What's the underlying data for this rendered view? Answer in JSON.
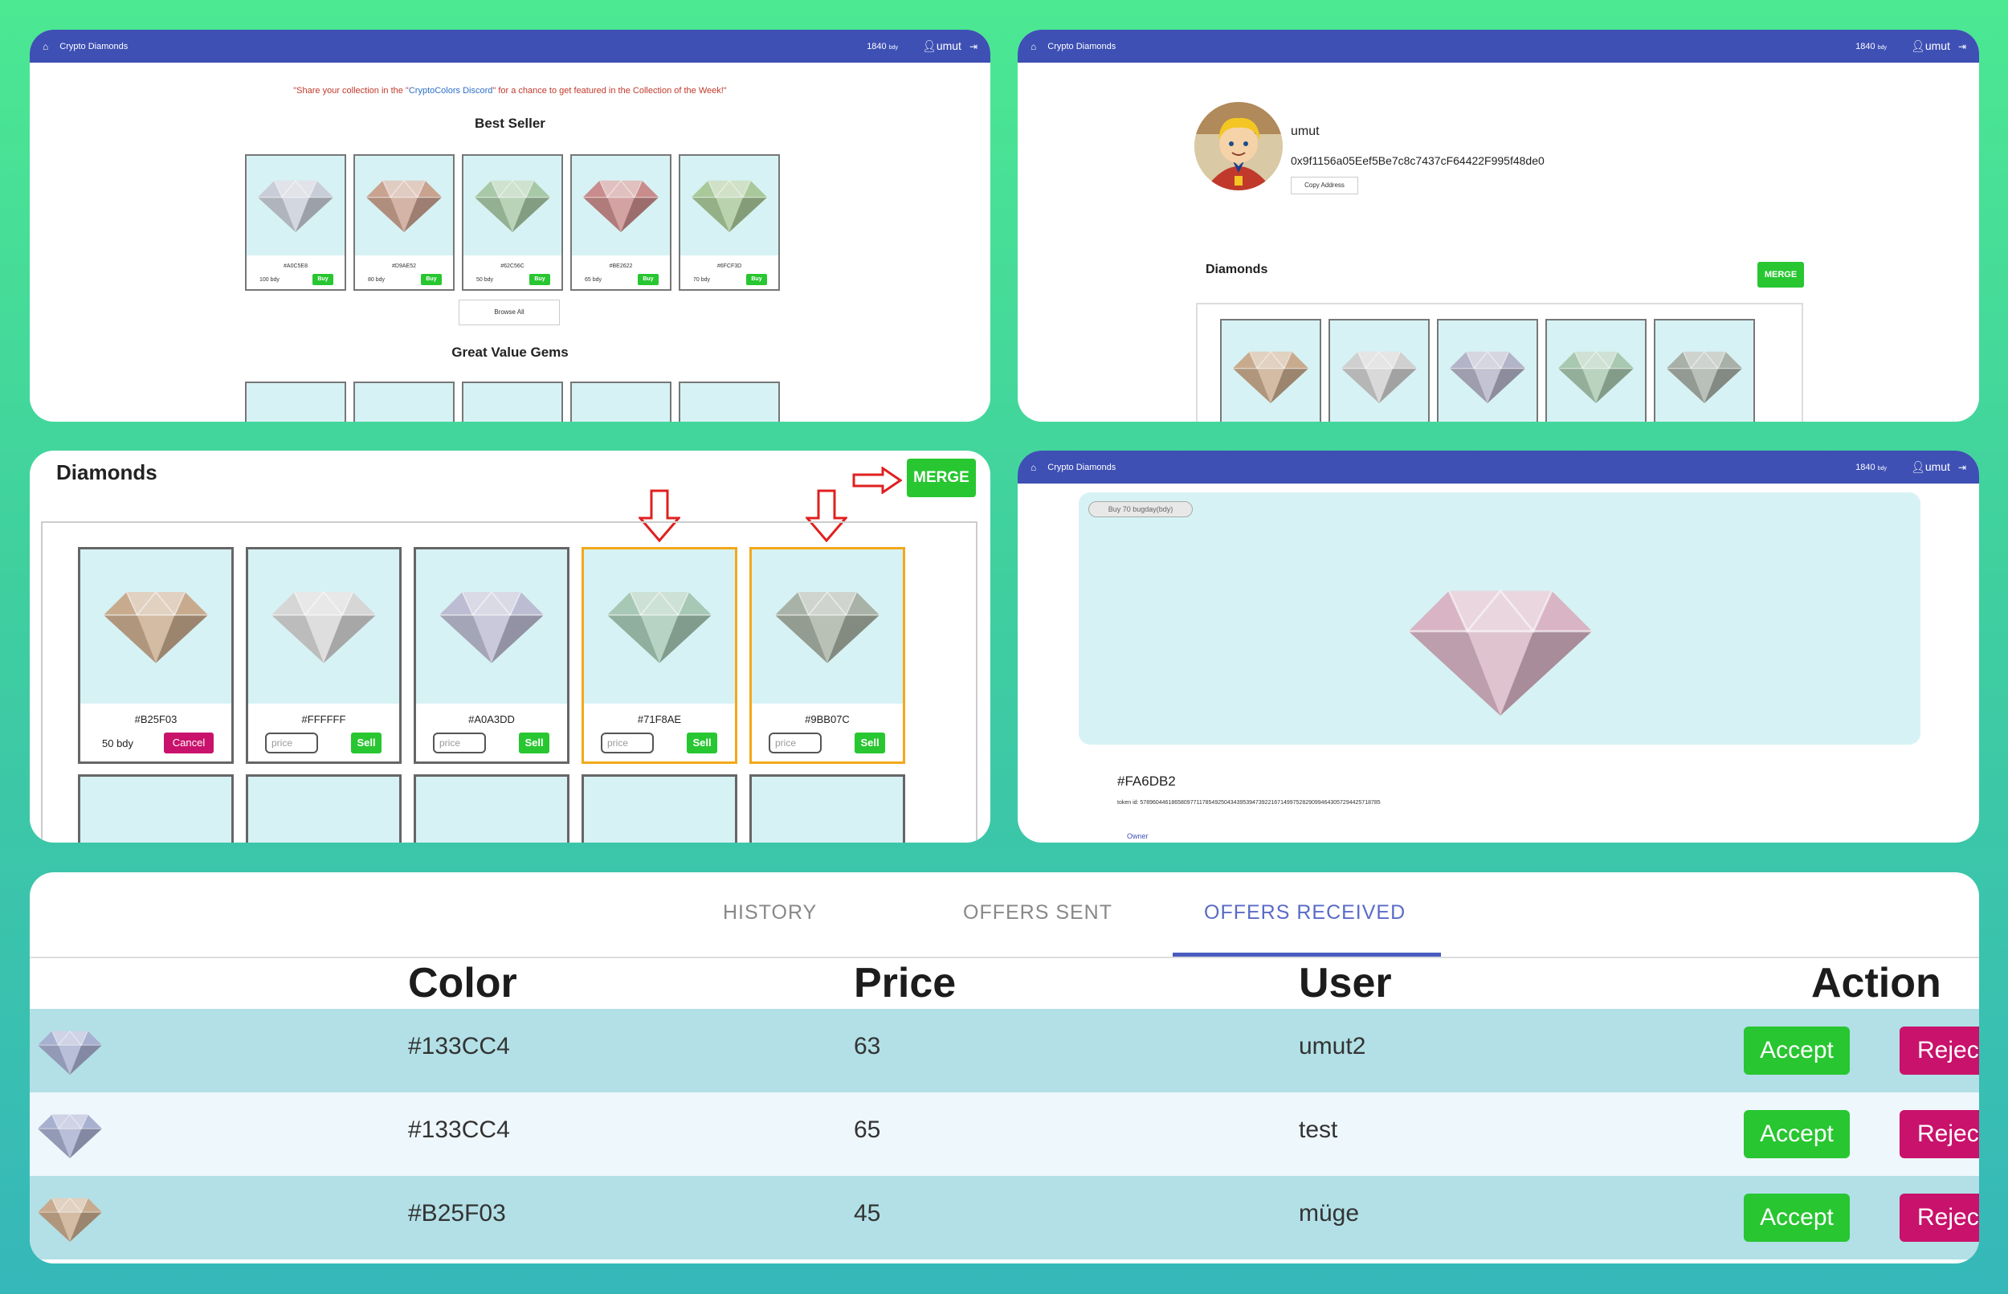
{
  "nav": {
    "brand": "Crypto Diamonds",
    "balance": "1840",
    "balance_unit": "bdy",
    "user": "umut"
  },
  "colors": {
    "nav_bg": "#3e50b4",
    "buy_green": "#28c631",
    "reject_pink": "#c9126b",
    "tile_bg": "#d6f2f4",
    "selected_border": "#f3a81a"
  },
  "marketplace": {
    "quote_pre": "\"Share your collection in the \"",
    "quote_link": "CryptoColors Discord",
    "quote_post": "\" for a chance to get featured in the Collection of the Week!\"",
    "best_seller_title": "Best Seller",
    "best_seller": [
      {
        "code": "#A0C5E8",
        "price": "100 bdy",
        "buy": "Buy",
        "gem": "#c8cdd8"
      },
      {
        "code": "#D9AE52",
        "price": "80 bdy",
        "buy": "Buy",
        "gem": "#c9a290"
      },
      {
        "code": "#62C56C",
        "price": "50 bdy",
        "buy": "Buy",
        "gem": "#a8c9a8"
      },
      {
        "code": "#BE2622",
        "price": "65 bdy",
        "buy": "Buy",
        "gem": "#c98c8c"
      },
      {
        "code": "#6FCF3D",
        "price": "70 bdy",
        "buy": "Buy",
        "gem": "#a9c99a"
      }
    ],
    "browse_label": "Browse All",
    "great_value_title": "Great Value Gems",
    "great_value_gems": [
      "#d9a8c4",
      "#c2a8d8",
      "#d2d2a8",
      "#b8b8c8",
      "#a8c8a8"
    ]
  },
  "profile": {
    "name": "umut",
    "address": "0x9f1156a05Eef5Be7c8c7437cF64422F995f48de0",
    "copy_label": "Copy Address",
    "diamonds_title": "Diamonds",
    "merge_label": "MERGE",
    "gems": [
      "#c8ab8e",
      "#d0d0d0",
      "#b4b4c8",
      "#a8c8b0",
      "#a8b0a8"
    ]
  },
  "diamonds": {
    "title": "Diamonds",
    "merge_label": "MERGE",
    "price_placeholder": "price",
    "sell_label": "Sell",
    "cancel_label": "Cancel",
    "items": [
      {
        "code": "#B25F03",
        "gem": "#c8ab8e",
        "selected": false,
        "owned": true,
        "price": "50 bdy"
      },
      {
        "code": "#FFFFFF",
        "gem": "#d6d6d6",
        "selected": false,
        "owned": false
      },
      {
        "code": "#A0A3DD",
        "gem": "#bcbcd2",
        "selected": false,
        "owned": false
      },
      {
        "code": "#71F8AE",
        "gem": "#a6c8b4",
        "selected": true,
        "owned": false
      },
      {
        "code": "#9BB07C",
        "gem": "#a8b2a6",
        "selected": true,
        "owned": false
      }
    ],
    "row2_gems": [
      "#a8b0d0",
      "#a8c0c0",
      "#c8a0a8",
      "#c2b89c",
      "#d2b8c8"
    ]
  },
  "detail": {
    "buy_label": "Buy 70 bugday(bdy)",
    "code": "#FA6DB2",
    "gem": "#d8b4c4",
    "token_id": "token id: 57896044618658097711785492504343953947392216714997528290994643057294425718785",
    "owner_label": "Owner"
  },
  "offers": {
    "tabs": [
      {
        "label": "HISTORY",
        "active": false
      },
      {
        "label": "OFFERS SENT",
        "active": false
      },
      {
        "label": "OFFERS RECEIVED",
        "active": true
      }
    ],
    "headers": {
      "color": "Color",
      "price": "Price",
      "user": "User",
      "action": "Action"
    },
    "accept_label": "Accept",
    "reject_label": "Reject",
    "rows": [
      {
        "color": "#133CC4",
        "price": "63",
        "user": "umut2",
        "gem": "#a8b0d0"
      },
      {
        "color": "#133CC4",
        "price": "65",
        "user": "test",
        "gem": "#a8b0d0"
      },
      {
        "color": "#B25F03",
        "price": "45",
        "user": "müge",
        "gem": "#c8ab8e"
      }
    ]
  }
}
